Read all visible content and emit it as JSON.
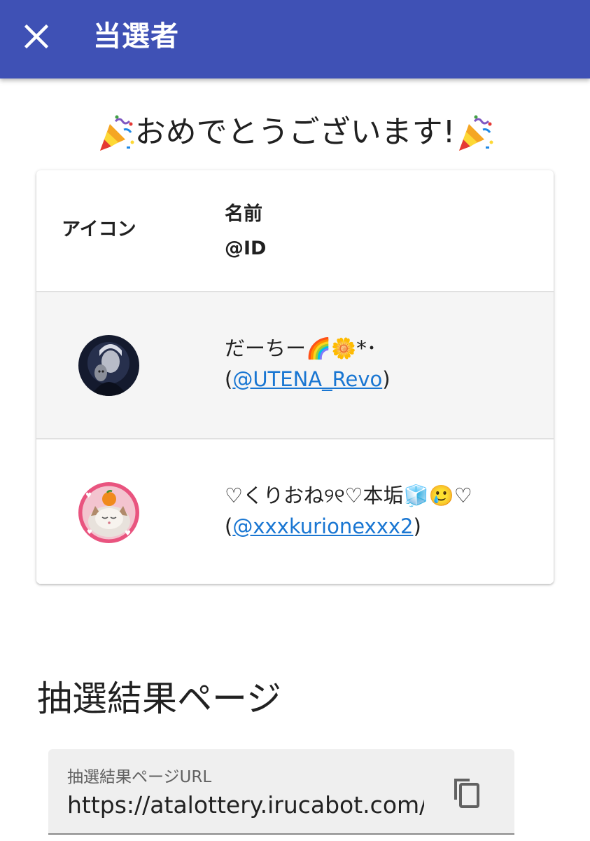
{
  "appbar": {
    "title": "当選者",
    "close_icon": "close-icon",
    "color": "#3f51b5"
  },
  "congrats": {
    "text": "おめでとうございます!",
    "emoji_left": "party-popper",
    "emoji_right": "party-popper"
  },
  "table": {
    "headers": {
      "icon": "アイコン",
      "name": "名前",
      "id": "@ID"
    },
    "rows": [
      {
        "name": "だーちー🌈🌼*･",
        "id_prefix": "(",
        "id": "@UTENA_Revo",
        "id_suffix": ")",
        "avatar": "avatar-masked-figure"
      },
      {
        "name": "♡くりおね୨୧♡本垢🧊🥲♡",
        "id_prefix": "(",
        "id": "@xxxkurionexxx2",
        "id_suffix": ")",
        "avatar": "avatar-cat-with-orange"
      }
    ]
  },
  "result_section": {
    "title": "抽選結果ページ",
    "field_label": "抽選結果ページURL",
    "field_value": "https://atalottery.irucabot.com/r",
    "copy_icon": "copy-icon"
  },
  "colors": {
    "link": "#1976d2",
    "row_highlight": "#f5f5f5"
  }
}
